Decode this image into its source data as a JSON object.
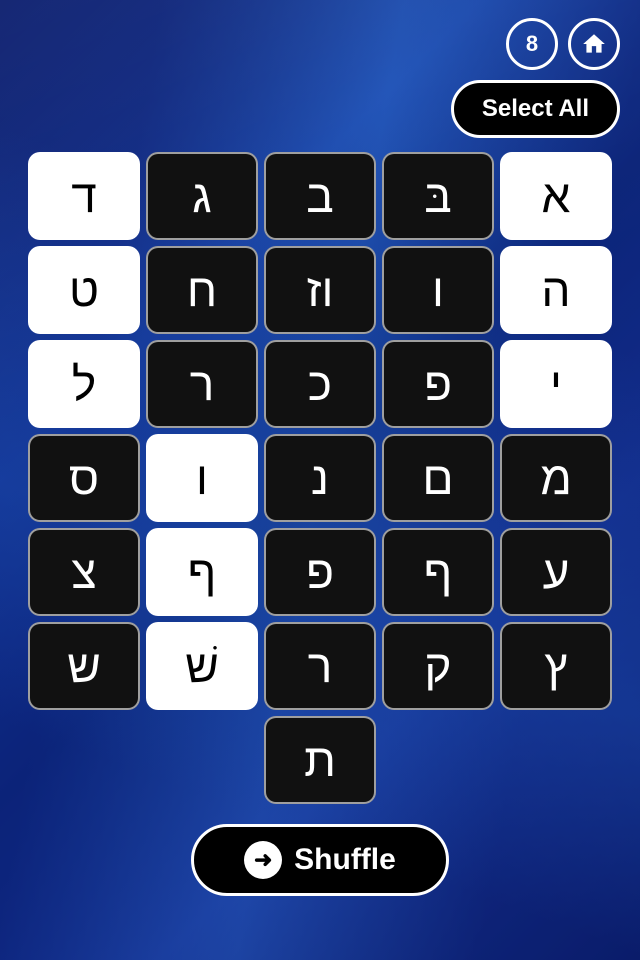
{
  "header": {
    "score": "8",
    "select_all_label": "Select All"
  },
  "grid": {
    "rows": [
      [
        {
          "letter": "ד",
          "style": "light"
        },
        {
          "letter": "ג",
          "style": "dark"
        },
        {
          "letter": "ב",
          "style": "dark"
        },
        {
          "letter": "בּ",
          "style": "dark"
        },
        {
          "letter": "א",
          "style": "light"
        }
      ],
      [
        {
          "letter": "ט",
          "style": "light"
        },
        {
          "letter": "ח",
          "style": "dark"
        },
        {
          "letter": "וז",
          "style": "dark"
        },
        {
          "letter": "ו",
          "style": "dark"
        },
        {
          "letter": "ה",
          "style": "light"
        }
      ],
      [
        {
          "letter": "ל",
          "style": "light"
        },
        {
          "letter": "ר",
          "style": "dark"
        },
        {
          "letter": "כ",
          "style": "dark"
        },
        {
          "letter": "פ",
          "style": "dark"
        },
        {
          "letter": "י",
          "style": "light"
        }
      ],
      [
        {
          "letter": "ס",
          "style": "dark"
        },
        {
          "letter": "ו",
          "style": "light"
        },
        {
          "letter": "נ",
          "style": "dark"
        },
        {
          "letter": "ם",
          "style": "dark"
        },
        {
          "letter": "מ",
          "style": "dark"
        }
      ],
      [
        {
          "letter": "צ",
          "style": "dark"
        },
        {
          "letter": "ף",
          "style": "light"
        },
        {
          "letter": "פ",
          "style": "dark"
        },
        {
          "letter": "ף",
          "style": "dark"
        },
        {
          "letter": "ע",
          "style": "dark"
        }
      ],
      [
        {
          "letter": "ש",
          "style": "dark"
        },
        {
          "letter": "שׁ",
          "style": "light"
        },
        {
          "letter": "ר",
          "style": "dark"
        },
        {
          "letter": "ק",
          "style": "dark"
        },
        {
          "letter": "ץ",
          "style": "dark"
        }
      ],
      [
        {
          "letter": "",
          "style": "empty"
        },
        {
          "letter": "",
          "style": "empty"
        },
        {
          "letter": "ת",
          "style": "dark"
        },
        {
          "letter": "",
          "style": "empty"
        },
        {
          "letter": "",
          "style": "empty"
        }
      ]
    ]
  },
  "footer": {
    "shuffle_label": "Shuffle"
  }
}
